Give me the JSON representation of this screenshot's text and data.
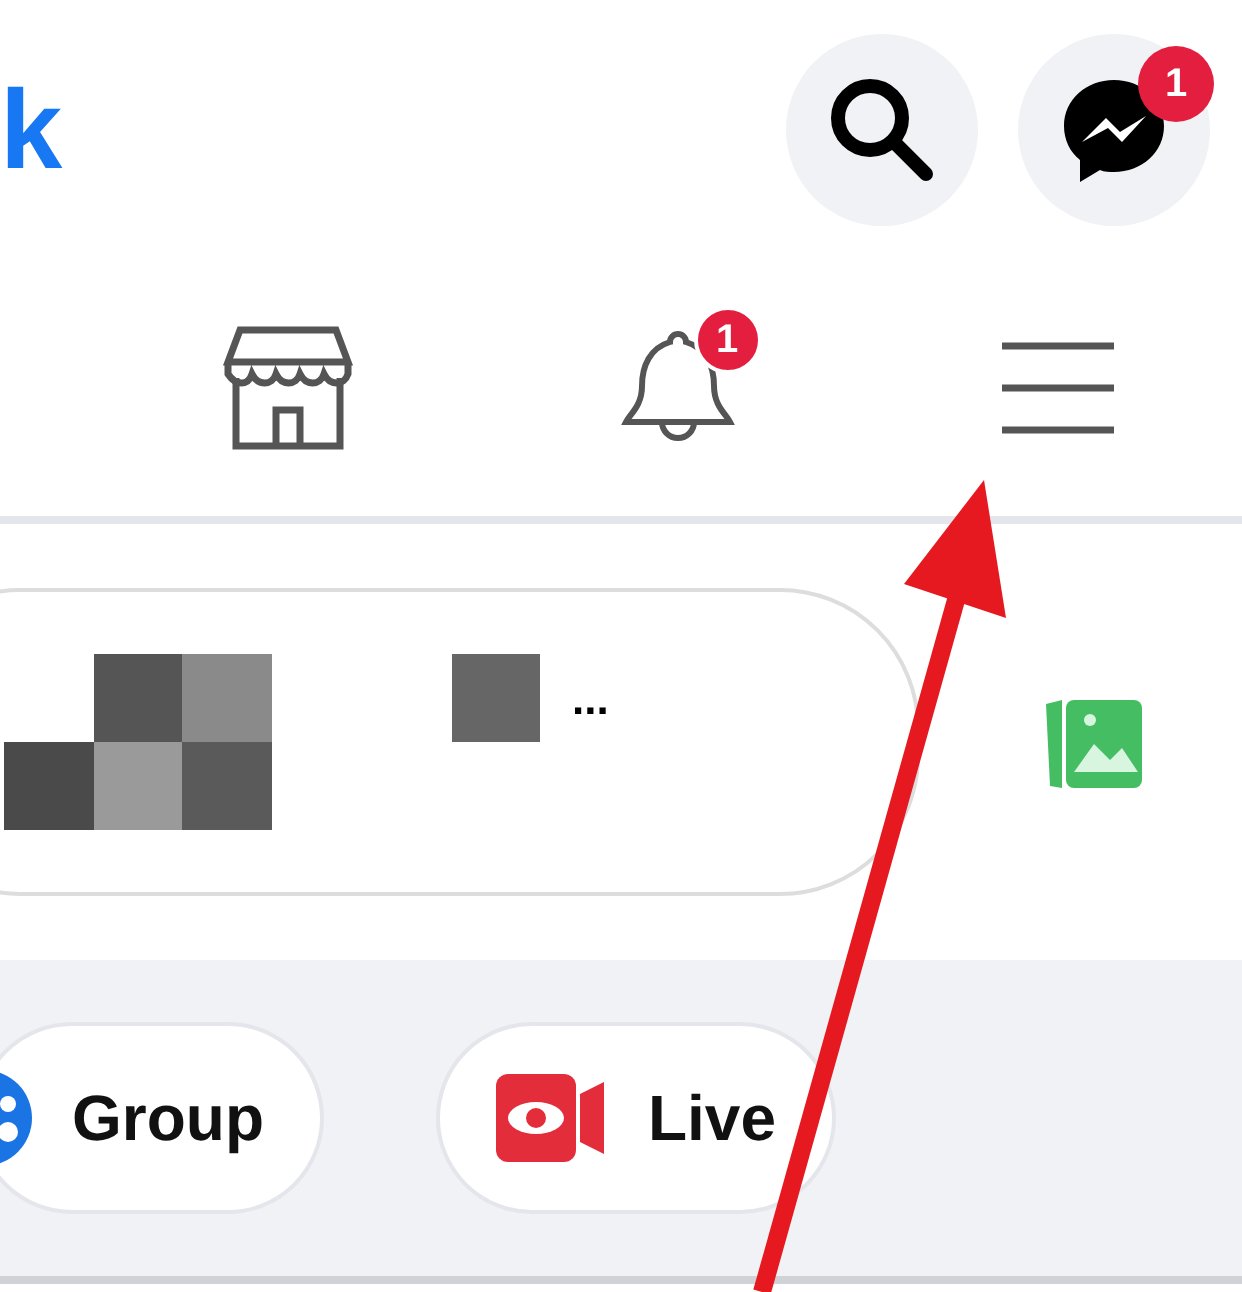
{
  "header": {
    "logo": "k",
    "messenger_badge": "1"
  },
  "nav": [
    {
      "kind": "store"
    },
    {
      "kind": "bell",
      "badge": "1"
    },
    {
      "kind": "menu"
    }
  ],
  "composer": {
    "text": "..."
  },
  "chips": [
    {
      "kind": "group",
      "label": "Group"
    },
    {
      "kind": "live",
      "label": "Live"
    }
  ]
}
